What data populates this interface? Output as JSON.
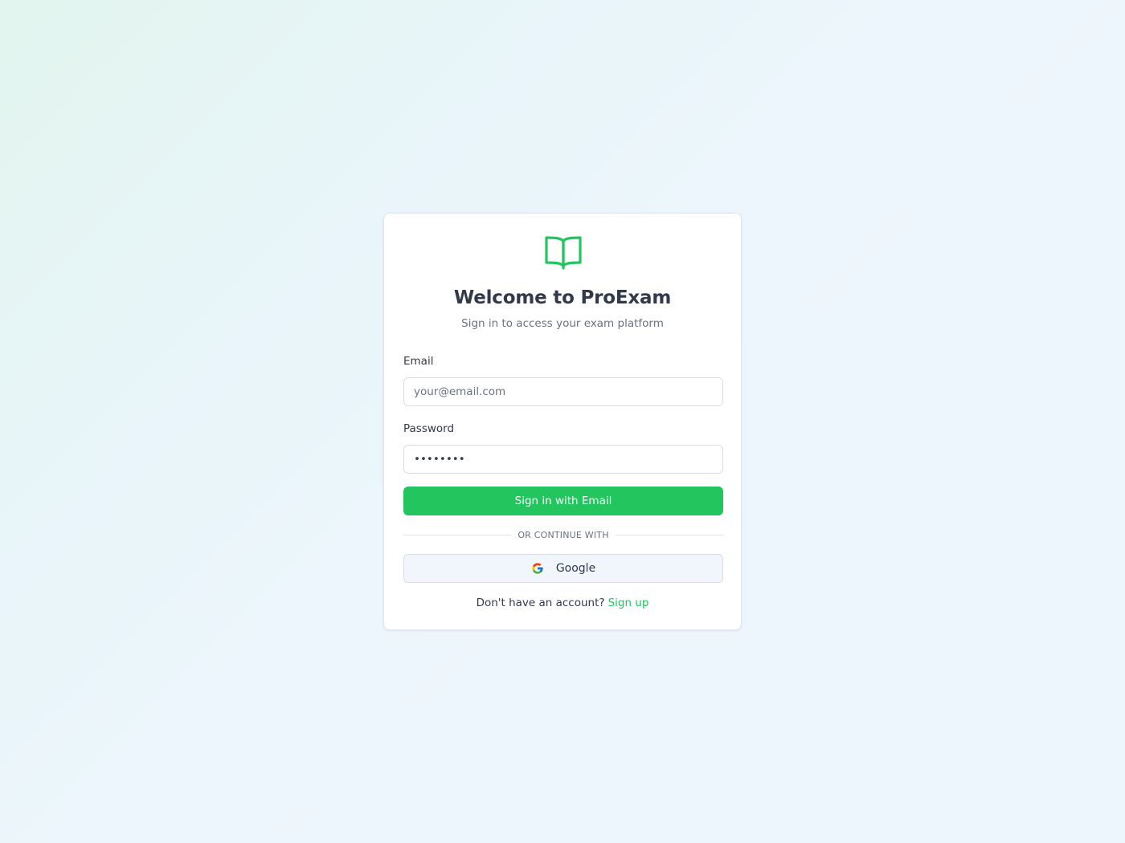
{
  "login": {
    "title": "Welcome to ProExam",
    "subtitle": "Sign in to access your exam platform",
    "email_label": "Email",
    "email_placeholder": "your@email.com",
    "password_label": "Password",
    "password_value": "••••••••",
    "submit_label": "Sign in with Email",
    "divider_text": "OR CONTINUE WITH",
    "google_label": "Google",
    "signup_prompt": "Don't have an account?",
    "signup_link": "Sign up"
  },
  "icons": {
    "logo": "book-open-icon",
    "google": "google-icon"
  },
  "colors": {
    "accent": "#22c55e",
    "title": "#313a4b",
    "muted": "#6b7280"
  }
}
